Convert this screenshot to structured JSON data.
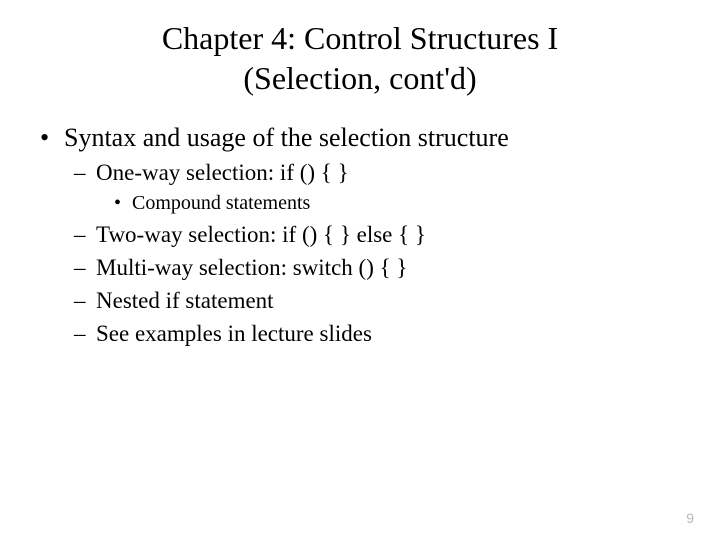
{
  "title_line1": "Chapter 4: Control Structures I",
  "title_line2": "(Selection, cont'd)",
  "bullets": {
    "l1_0": "Syntax and usage of the selection structure",
    "l2_0": "One-way selection: if () {   }",
    "l3_0": "Compound statements",
    "l2_1": "Two-way selection: if () {   } else { }",
    "l2_2": "Multi-way selection: switch () {     }",
    "l2_3": "Nested if statement",
    "l2_4": "See examples in lecture slides"
  },
  "page_number": "9"
}
